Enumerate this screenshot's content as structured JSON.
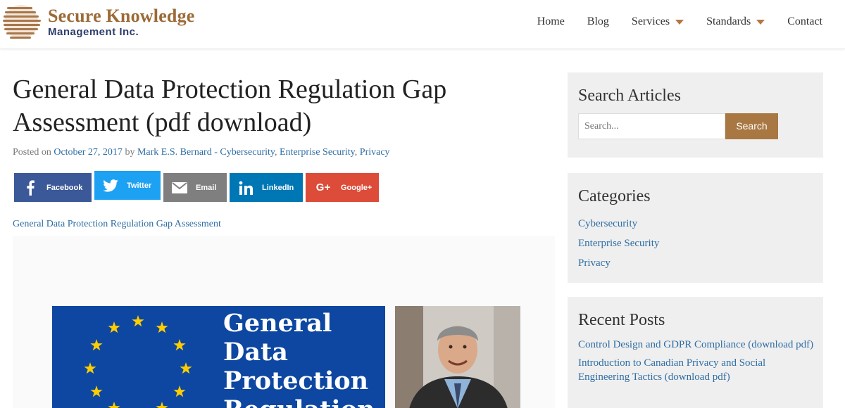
{
  "header": {
    "logo_line1": "Secure Knowledge",
    "logo_line2": "Management Inc.",
    "nav": [
      {
        "label": "Home",
        "has_caret": false
      },
      {
        "label": "Blog",
        "has_caret": false
      },
      {
        "label": "Services",
        "has_caret": true
      },
      {
        "label": "Standards",
        "has_caret": true
      },
      {
        "label": "Contact",
        "has_caret": false
      }
    ]
  },
  "post": {
    "title": "General Data Protection Regulation Gap Assessment (pdf download)",
    "meta": {
      "posted_on_label": "Posted on",
      "date": "October 27, 2017",
      "by_label": "by",
      "author": "Mark E.S. Bernard",
      "separator": " - ",
      "categories": [
        "Cybersecurity",
        "Enterprise Security",
        "Privacy"
      ]
    },
    "share": {
      "facebook": "Facebook",
      "twitter": "Twitter",
      "email": "Email",
      "linkedin": "LinkedIn",
      "google": "Google+"
    },
    "pdf_link": "General Data Protection Regulation Gap Assessment",
    "image_text": [
      "General",
      "Data",
      "Protection",
      "Regulation"
    ]
  },
  "sidebar": {
    "search": {
      "title": "Search Articles",
      "placeholder": "Search...",
      "button": "Search"
    },
    "categories": {
      "title": "Categories",
      "items": [
        "Cybersecurity",
        "Enterprise Security",
        "Privacy"
      ]
    },
    "recent": {
      "title": "Recent Posts",
      "items": [
        "Control Design and GDPR Compliance (download pdf)",
        "Introduction to Canadian Privacy and Social Engineering Tactics (download pdf)"
      ]
    }
  },
  "colors": {
    "brand_brown": "#9b6a36",
    "brand_navy": "#2e3d6b",
    "link": "#2e6da4",
    "search_button": "#a97842",
    "facebook": "#3b5998",
    "twitter": "#1da1f2",
    "email": "#7f7f7f",
    "linkedin": "#0077b5",
    "google": "#dd4b39",
    "eu_blue": "#0d47a1",
    "eu_star": "#ffcc00"
  }
}
